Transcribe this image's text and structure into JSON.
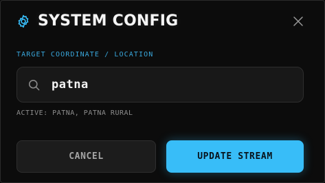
{
  "dialog": {
    "title": "SYSTEM CONFIG",
    "header_icon": "gear-icon",
    "close_icon": "close-icon"
  },
  "location_field": {
    "label": "TARGET COORDINATE / LOCATION",
    "value": "patna",
    "icon": "search-icon",
    "active_text": "ACTIVE: PATNA, PATNA RURAL"
  },
  "actions": {
    "cancel_label": "CANCEL",
    "update_label": "UPDATE STREAM"
  },
  "colors": {
    "accent": "#38bdf8",
    "label": "#39a7dc",
    "background": "#0c0c0c"
  }
}
